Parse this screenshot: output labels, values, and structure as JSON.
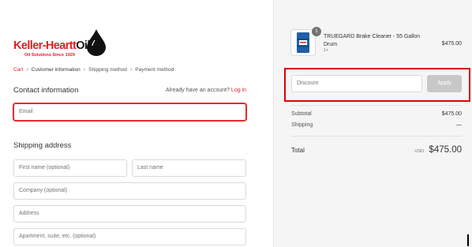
{
  "logo": {
    "brand": "Keller-Heartt",
    "brand_oil": "Oil",
    "tagline": "Oil Solutions Since 1929"
  },
  "breadcrumb": {
    "items": [
      "Cart",
      "Customer information",
      "Shipping method",
      "Payment method"
    ]
  },
  "contact": {
    "title": "Contact information",
    "account_prompt": "Already have an account?",
    "login_label": "Log in",
    "email_placeholder": "Email"
  },
  "shipping": {
    "title": "Shipping address",
    "first_name_placeholder": "First name (optional)",
    "last_name_placeholder": "Last name",
    "company_placeholder": "Company (optional)",
    "address_placeholder": "Address",
    "apartment_placeholder": "Apartment, suite, etc. (optional)"
  },
  "order": {
    "quantity_badge": "1",
    "product_name": "TRUEGARD Brake Cleaner - 55 Gallon Drum",
    "product_variant": "1+",
    "product_price": "$475.00",
    "discount_placeholder": "Discount",
    "apply_label": "Apply",
    "subtotal_label": "Subtotal",
    "subtotal_value": "$475.00",
    "shipping_label": "Shipping",
    "shipping_value": "—",
    "total_label": "Total",
    "total_currency": "USD",
    "total_value": "$475.00"
  },
  "colors": {
    "brand_red": "#e31e24",
    "highlight_red": "#e00000",
    "drum_blue": "#1f5fa8"
  },
  "icons": {
    "logo_drop": "oil-drop-icon",
    "breadcrumb_separator": "chevron-right-icon",
    "product_image": "drum-icon"
  }
}
